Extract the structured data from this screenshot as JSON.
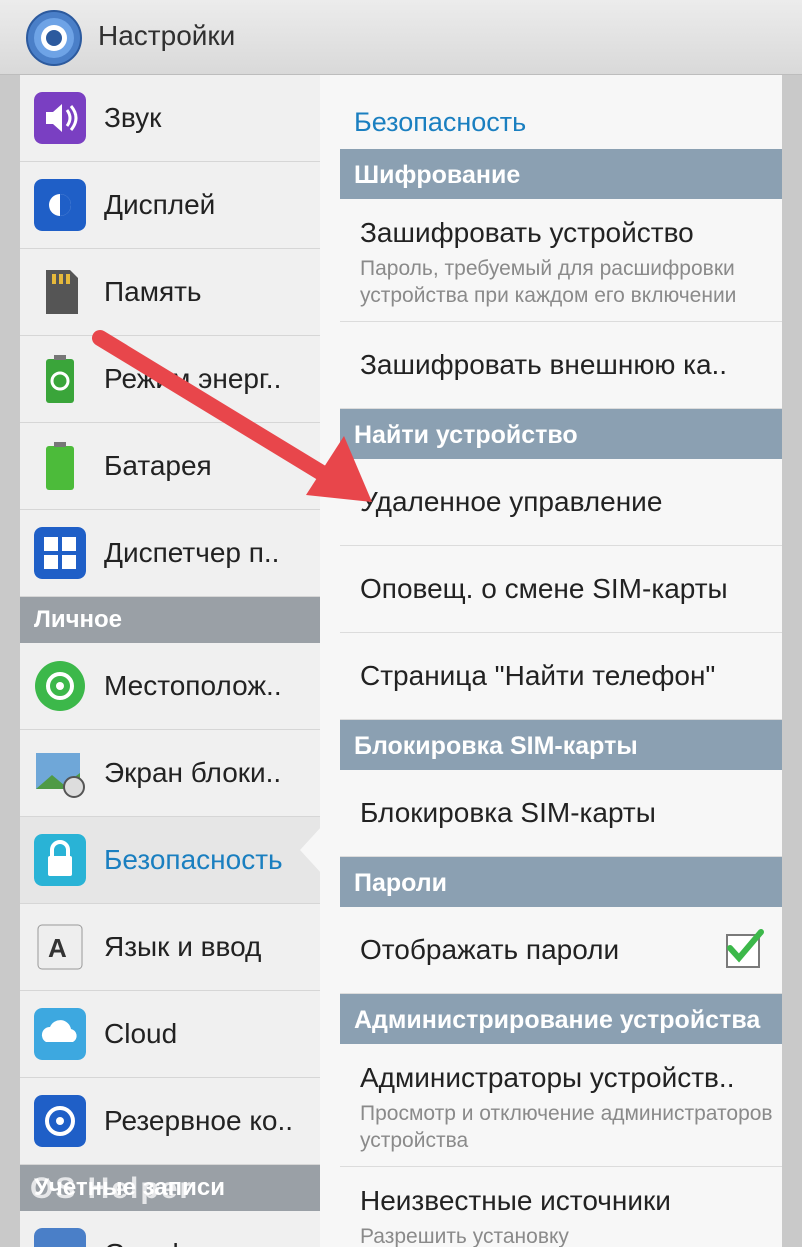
{
  "app": {
    "title": "Настройки"
  },
  "left": {
    "items_top": [
      {
        "label": "Звук",
        "icon": "speaker-icon"
      },
      {
        "label": "Дисплей",
        "icon": "display-icon"
      },
      {
        "label": "Память",
        "icon": "sd-card-icon"
      },
      {
        "label": "Режим энерг..",
        "icon": "power-saving-icon"
      },
      {
        "label": "Батарея",
        "icon": "battery-icon"
      },
      {
        "label": "Диспетчер п..",
        "icon": "app-manager-icon"
      }
    ],
    "header_personal": "Личное",
    "items_personal": [
      {
        "label": "Местополож..",
        "icon": "location-icon"
      },
      {
        "label": "Экран блоки..",
        "icon": "lock-screen-icon"
      },
      {
        "label": "Безопасность",
        "icon": "security-lock-icon"
      },
      {
        "label": "Язык и ввод",
        "icon": "language-keyboard-icon"
      },
      {
        "label": "Cloud",
        "icon": "cloud-icon"
      },
      {
        "label": "Резервное ко..",
        "icon": "backup-icon"
      }
    ],
    "header_accounts": "Учетные записи",
    "item_google": "Google"
  },
  "right": {
    "page_title": "Безопасность",
    "sections": {
      "encryption": {
        "header": "Шифрование",
        "encrypt_device": "Зашифровать устройство",
        "encrypt_device_sub": "Пароль, требуемый для расшифровки устройства при каждом его включении",
        "encrypt_external": "Зашифровать внешнюю ка.."
      },
      "find_device": {
        "header": "Найти устройство",
        "remote_control": "Удаленное управление",
        "sim_change": "Оповещ. о смене SIM-карты",
        "find_phone_page": "Страница \"Найти телефон\""
      },
      "sim_lock": {
        "header": "Блокировка SIM-карты",
        "item": "Блокировка SIM-карты"
      },
      "passwords": {
        "header": "Пароли",
        "show_passwords": "Отображать пароли",
        "show_passwords_checked": true
      },
      "admin": {
        "header": "Администрирование устройства",
        "admins": "Администраторы устройств..",
        "admins_sub": "Просмотр и отключение администраторов устройства",
        "unknown_sources": "Неизвестные источники",
        "unknown_sources_sub": "Разрешить установку"
      }
    }
  },
  "watermark": "OS Helper",
  "colors": {
    "accent": "#1a7fc0",
    "arrow": "#e8464b",
    "section_header": "#8ba0b2"
  }
}
